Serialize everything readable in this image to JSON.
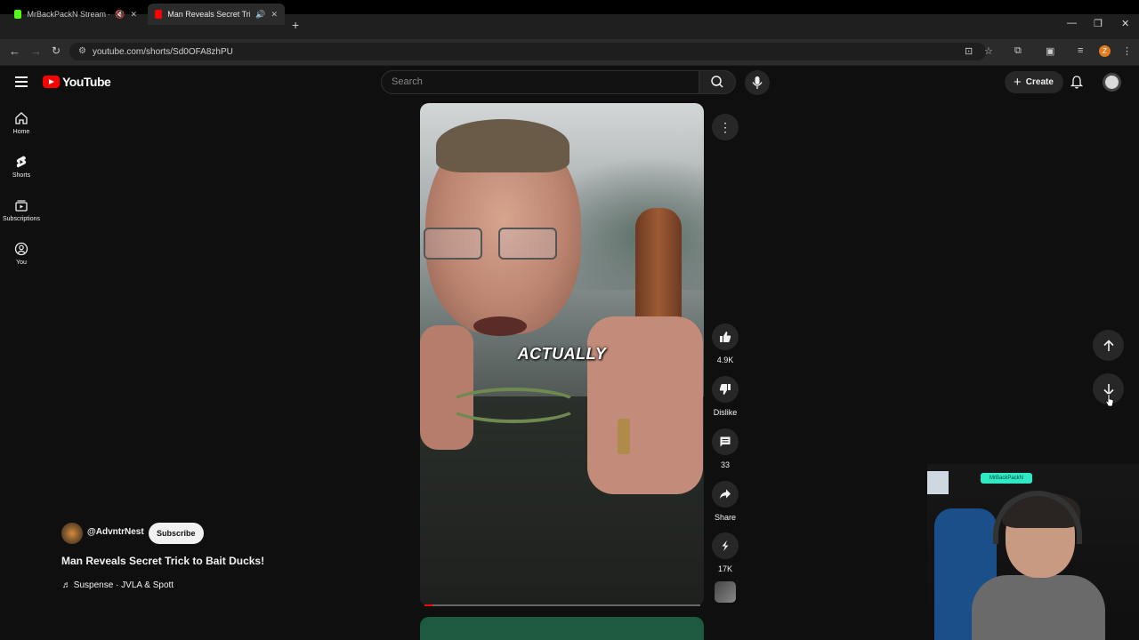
{
  "browser": {
    "tabs": [
      {
        "title": "MrBackPackN Stream - Wa",
        "active": false,
        "favicon_color": "#53fc18"
      },
      {
        "title": "Man Reveals Secret Trick to",
        "active": true,
        "favicon_color": "#ff0000"
      }
    ],
    "url": "youtube.com/shorts/Sd0OFA8zhPU",
    "profile_initial": "Z"
  },
  "header": {
    "logo_text": "YouTube",
    "search_placeholder": "Search",
    "create_label": "Create"
  },
  "sidebar": {
    "items": [
      {
        "label": "Home",
        "icon": "home-icon"
      },
      {
        "label": "Shorts",
        "icon": "shorts-icon"
      },
      {
        "label": "Subscriptions",
        "icon": "subscriptions-icon"
      },
      {
        "label": "You",
        "icon": "you-icon"
      }
    ]
  },
  "short": {
    "caption": "ACTUALLY",
    "progress": 0.03,
    "channel": "@AdvntrNest",
    "subscribe_label": "Subscribe",
    "title": "Man Reveals Secret Trick to Bait Ducks!",
    "music": "Suspense · JVLA & Spott"
  },
  "actions": {
    "like_count": "4.9K",
    "dislike_label": "Dislike",
    "comments_count": "33",
    "share_label": "Share",
    "remix_count": "17K"
  },
  "webcam": {
    "neon_text": "MrBackPackN"
  },
  "colors": {
    "accent": "#ff0000",
    "background": "#0f0f0f"
  }
}
